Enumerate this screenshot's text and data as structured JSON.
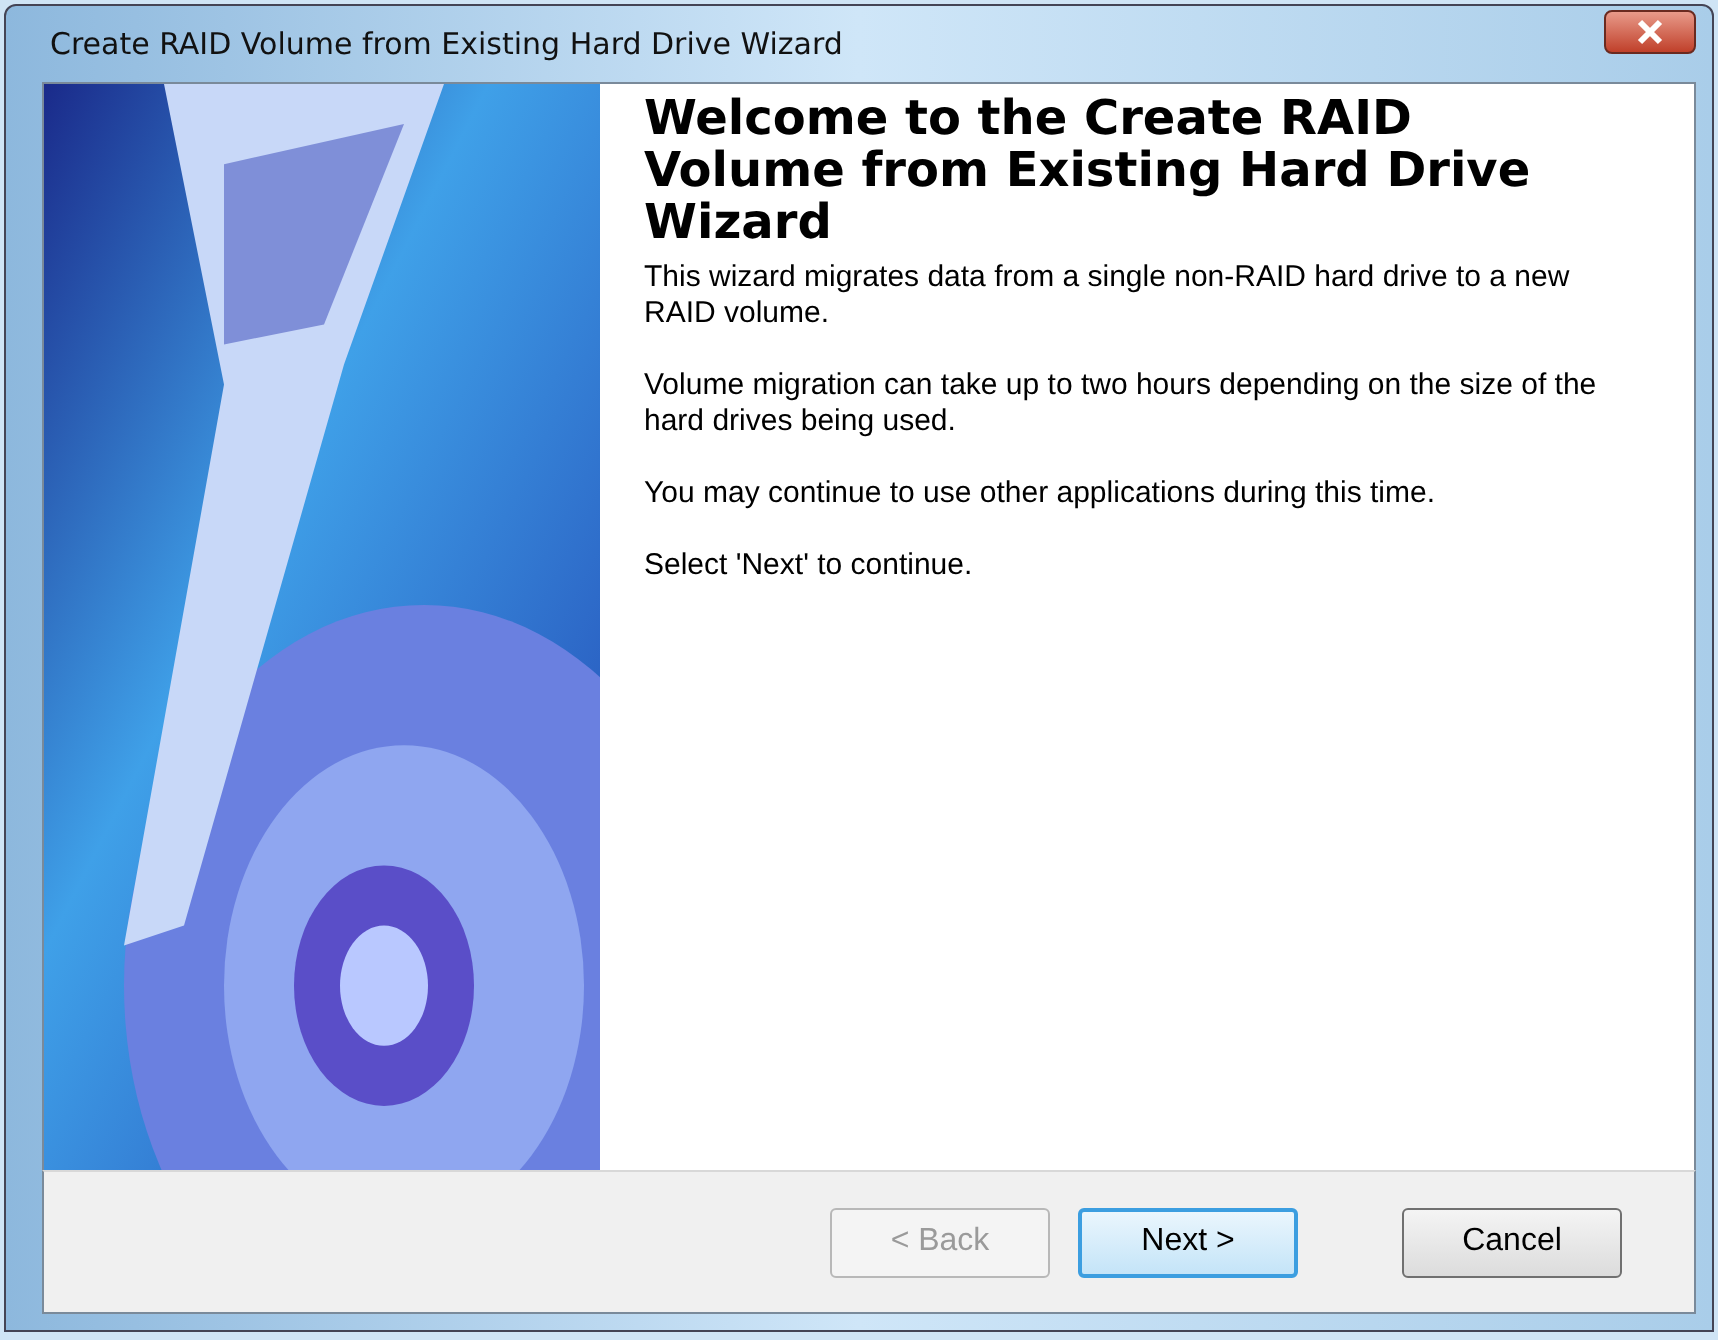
{
  "window": {
    "title": "Create RAID Volume from Existing Hard Drive Wizard"
  },
  "heading": "Welcome to the Create RAID Volume from Existing Hard Drive Wizard",
  "paragraphs": [
    "This wizard migrates data from a single non-RAID hard drive to a new RAID volume.",
    "Volume migration can take up to two hours depending on the size of the hard drives being used.",
    "You may continue to use other applications during this time.",
    "Select 'Next' to continue."
  ],
  "buttons": [
    {
      "label": "< Back",
      "disabled": true,
      "focused": false
    },
    {
      "label": "Next >",
      "disabled": false,
      "focused": true
    },
    {
      "label": "Cancel",
      "disabled": false,
      "focused": false
    }
  ]
}
